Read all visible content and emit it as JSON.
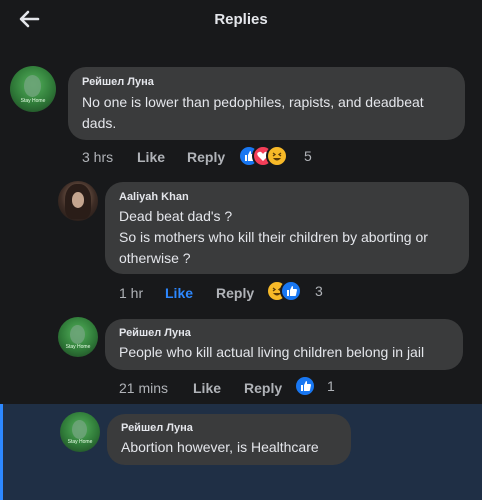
{
  "header": {
    "title": "Replies"
  },
  "comments": [
    {
      "author": "Рейшел Луна",
      "avatar_text": "Stay Home",
      "text": "No one is lower than pedophiles, rapists, and deadbeat\ndads.",
      "time": "3 hrs",
      "like": "Like",
      "reply": "Reply",
      "reactions": [
        "like-icon",
        "love-icon",
        "haha-icon"
      ],
      "count": "5"
    },
    {
      "author": "Aaliyah Khan",
      "text": "Dead beat dad's ?\nSo is mothers who kill their children by aborting or\notherwise ?",
      "time": "1 hr",
      "like": "Like",
      "reply": "Reply",
      "liked": true,
      "reactions": [
        "haha-icon",
        "like-icon"
      ],
      "count": "3"
    },
    {
      "author": "Рейшел Луна",
      "avatar_text": "Stay Home",
      "text": "People who kill actual living children belong in jail",
      "time": "21 mins",
      "like": "Like",
      "reply": "Reply",
      "reactions": [
        "like-icon"
      ],
      "count": "1"
    },
    {
      "author": "Рейшел Луна",
      "avatar_text": "Stay Home",
      "text": "Abortion however, is Healthcare"
    }
  ],
  "colors": {
    "background": "#18191b",
    "bubble": "#3a3b3c",
    "accent": "#2d88ff",
    "highlight": "#1f2f45"
  }
}
